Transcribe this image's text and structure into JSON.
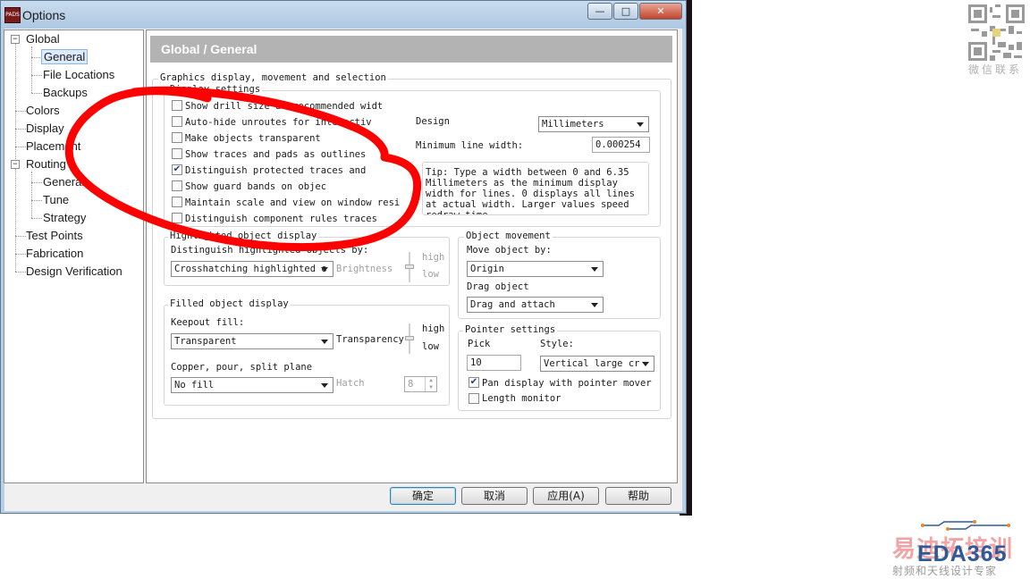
{
  "window": {
    "title": "Options",
    "app_icon_text": "PADS",
    "minimize_glyph": "—",
    "maximize_glyph": "□",
    "close_glyph": "✕"
  },
  "tree": {
    "global": "Global",
    "general": "General",
    "file_locations": "File Locations",
    "backups": "Backups",
    "colors": "Colors",
    "display": "Display",
    "placement": "Placement",
    "routing": "Routing",
    "routing_general": "General",
    "tune": "Tune",
    "strategy": "Strategy",
    "test_points": "Test Points",
    "fabrication": "Fabrication",
    "design_verification": "Design Verification",
    "expanded_glyph": "−"
  },
  "panel": {
    "title": "Global / General",
    "graphics_group": "Graphics display, movement and selection",
    "display_settings": {
      "legend": "Display settings",
      "items": [
        {
          "label": "Show drill size at recommended widt",
          "checked": false
        },
        {
          "label": "Auto-hide unroutes for interactiv",
          "checked": false
        },
        {
          "label": "Make objects transparent",
          "checked": false
        },
        {
          "label": "Show traces and pads as outlines",
          "checked": false
        },
        {
          "label": "Distinguish protected traces and",
          "checked": true
        },
        {
          "label": "Show guard bands on objec",
          "checked": false
        },
        {
          "label": "Maintain scale and view on window resi",
          "checked": false
        },
        {
          "label": "Distinguish component rules traces",
          "checked": false
        }
      ],
      "check_glyph": "✔",
      "design_label": "Design",
      "design_units": "Millimeters",
      "min_line_width_label": "Minimum line width:",
      "min_line_width_value": "0.000254",
      "tip_lines": [
        "Tip: Type a width between 0 and 6.35",
        "Millimeters as the minimum display",
        "width for lines. 0 displays all lines",
        "at actual width. Larger values speed",
        "redraw time."
      ]
    },
    "highlighted": {
      "legend": "Highlighted object display",
      "distinguish_label": "Distinguish highlighted objects by:",
      "mode": "Crosshatching highlighted o",
      "brightness_label": "Brightness",
      "high": "high",
      "low": "low"
    },
    "filled": {
      "legend": "Filled object display",
      "keepout_label": "Keepout fill:",
      "keepout_value": "Transparent",
      "transparency_label": "Transparency",
      "high": "high",
      "low": "low",
      "copper_label": "Copper, pour, split plane",
      "copper_value": "No fill",
      "hatch_label": "Hatch",
      "hatch_value": "8"
    },
    "movement": {
      "legend": "Object movement",
      "move_label": "Move object by:",
      "move_value": "Origin",
      "drag_label": "Drag object",
      "drag_value": "Drag and attach"
    },
    "pointer": {
      "legend": "Pointer settings",
      "pick_label": "Pick",
      "pick_value": "10",
      "style_label": "Style:",
      "style_value": "Vertical large cr",
      "pan_label": "Pan display with pointer mover",
      "pan_checked": true,
      "length_label": "Length monitor",
      "length_checked": false
    }
  },
  "buttons": {
    "ok": "确定",
    "cancel": "取消",
    "apply": "应用(A)",
    "help": "帮助"
  },
  "watermarks": {
    "qr_caption": "微信联系",
    "brand_cn": "易迪拓培训",
    "brand_en": "EDA365",
    "brand_sub": "射频和天线设计专家"
  },
  "colors": {
    "annotation_red": "#ff0000",
    "title_bar": "#b7cfe6",
    "panel_title_bg": "#b3b3b3"
  }
}
